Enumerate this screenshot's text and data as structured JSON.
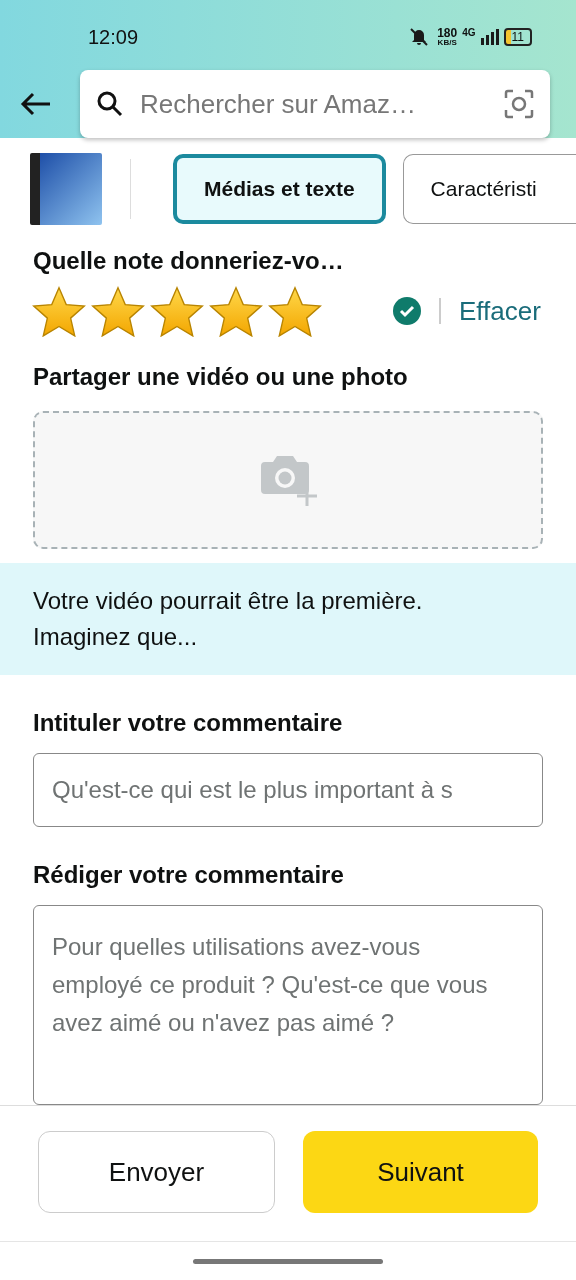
{
  "status_bar": {
    "time": "12:09",
    "speed": "180",
    "speed_unit": "KB/S",
    "network": "4G",
    "battery": "11"
  },
  "search": {
    "placeholder": "Rechercher sur Amaz…"
  },
  "tabs": [
    {
      "label": "Médias et texte",
      "selected": true
    },
    {
      "label": "Caractéristi",
      "selected": false
    }
  ],
  "rating": {
    "title": "Quelle note donneriez-vo…",
    "stars": 5,
    "clear_link": "Effacer"
  },
  "media": {
    "title": "Partager une vidéo ou une photo"
  },
  "banner": {
    "text": "Votre vidéo pourrait être la première. Imaginez que..."
  },
  "review_title": {
    "label": "Intituler votre commentaire",
    "placeholder": "Qu'est-ce qui est le plus important à s"
  },
  "review_body": {
    "label": "Rédiger votre commentaire",
    "placeholder": "Pour quelles utilisations avez-vous employé ce produit ? Qu'est-ce que vous avez aimé ou n'avez pas aimé ?"
  },
  "buttons": [
    {
      "label": "Envoyer",
      "kind": "secondary"
    },
    {
      "label": "Suivant",
      "kind": "primary"
    }
  ]
}
